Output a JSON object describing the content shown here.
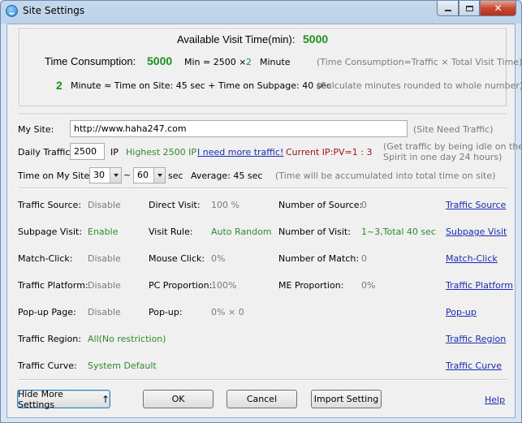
{
  "window": {
    "title": "Site Settings",
    "close_glyph": "✕"
  },
  "summary": {
    "available_label": "Available Visit Time(min):",
    "available_value": "5000",
    "consumption_label": "Time Consumption:",
    "consumption_value": "5000",
    "min_eq": "Min = 2500 ×",
    "multiplier": "2",
    "minute_label": "Minute",
    "consumption_note": "(Time Consumption=Traffic × Total Visit Time)",
    "minutes_value": "2",
    "minutes_formula": "Minute ≈ Time on Site: 45 sec + Time on Subpage: 40 sec",
    "minutes_note": "(Calculate minutes rounded to whole number)"
  },
  "mysite": {
    "label": "My Site:",
    "value": "http://www.haha247.com",
    "note": "(Site Need Traffic)"
  },
  "daily": {
    "label": "Daily Traffic:",
    "value": "2500",
    "ip_label": "IP",
    "highest": "Highest 2500 IP",
    "more_link": "I need more traffic!",
    "current": "Current IP:PV=1 : 3",
    "note_line1": "(Get traffic by being idle on the",
    "note_line2": "Spirit in one day 24 hours)"
  },
  "time_on_site": {
    "label": "Time on My Site:",
    "from": "30",
    "tilde": "~",
    "to": "60",
    "unit": "sec",
    "average": "Average: 45 sec",
    "note": "(Time will be accumulated into total time on site)"
  },
  "settings": {
    "traffic_source": {
      "label": "Traffic Source:",
      "value": "Disable",
      "link": "Traffic Source"
    },
    "direct_visit": {
      "label": "Direct Visit:",
      "value": "100 %"
    },
    "num_source": {
      "label": "Number of Source:",
      "value": "0"
    },
    "subpage_visit": {
      "label": "Subpage Visit:",
      "value": "Enable",
      "link": "Subpage Visit"
    },
    "visit_rule": {
      "label": "Visit Rule:",
      "value": "Auto Random"
    },
    "num_visit": {
      "label": "Number of Visit:",
      "value": "1~3,Total 40 sec"
    },
    "match_click": {
      "label": "Match-Click:",
      "value": "Disable",
      "link": "Match-Click"
    },
    "mouse_click": {
      "label": "Mouse Click:",
      "value": "0%"
    },
    "num_match": {
      "label": "Number of Match:",
      "value": "0"
    },
    "traffic_platform": {
      "label": "Traffic Platform:",
      "value": "Disable",
      "link": "Traffic Platform"
    },
    "pc_proportion": {
      "label": "PC Proportion:",
      "value": "100%"
    },
    "me_proportion": {
      "label": "ME Proportion:",
      "value": "0%"
    },
    "popup_page": {
      "label": "Pop-up Page:",
      "value": "Disable",
      "link": "Pop-up"
    },
    "popup": {
      "label": "Pop-up:",
      "value": "0% × 0"
    },
    "traffic_region": {
      "label": "Traffic Region:",
      "value": "All(No restriction)",
      "link": "Traffic Region"
    },
    "traffic_curve": {
      "label": "Traffic Curve:",
      "value": "System Default",
      "link": "Traffic Curve"
    }
  },
  "buttons": {
    "hide_more": "Hide More Settings",
    "ok": "OK",
    "cancel": "Cancel",
    "import": "Import Setting",
    "help": "Help"
  },
  "colors": {
    "green_value": "#1f8f1f",
    "link": "#1a2bb5",
    "red": "#a01818"
  }
}
